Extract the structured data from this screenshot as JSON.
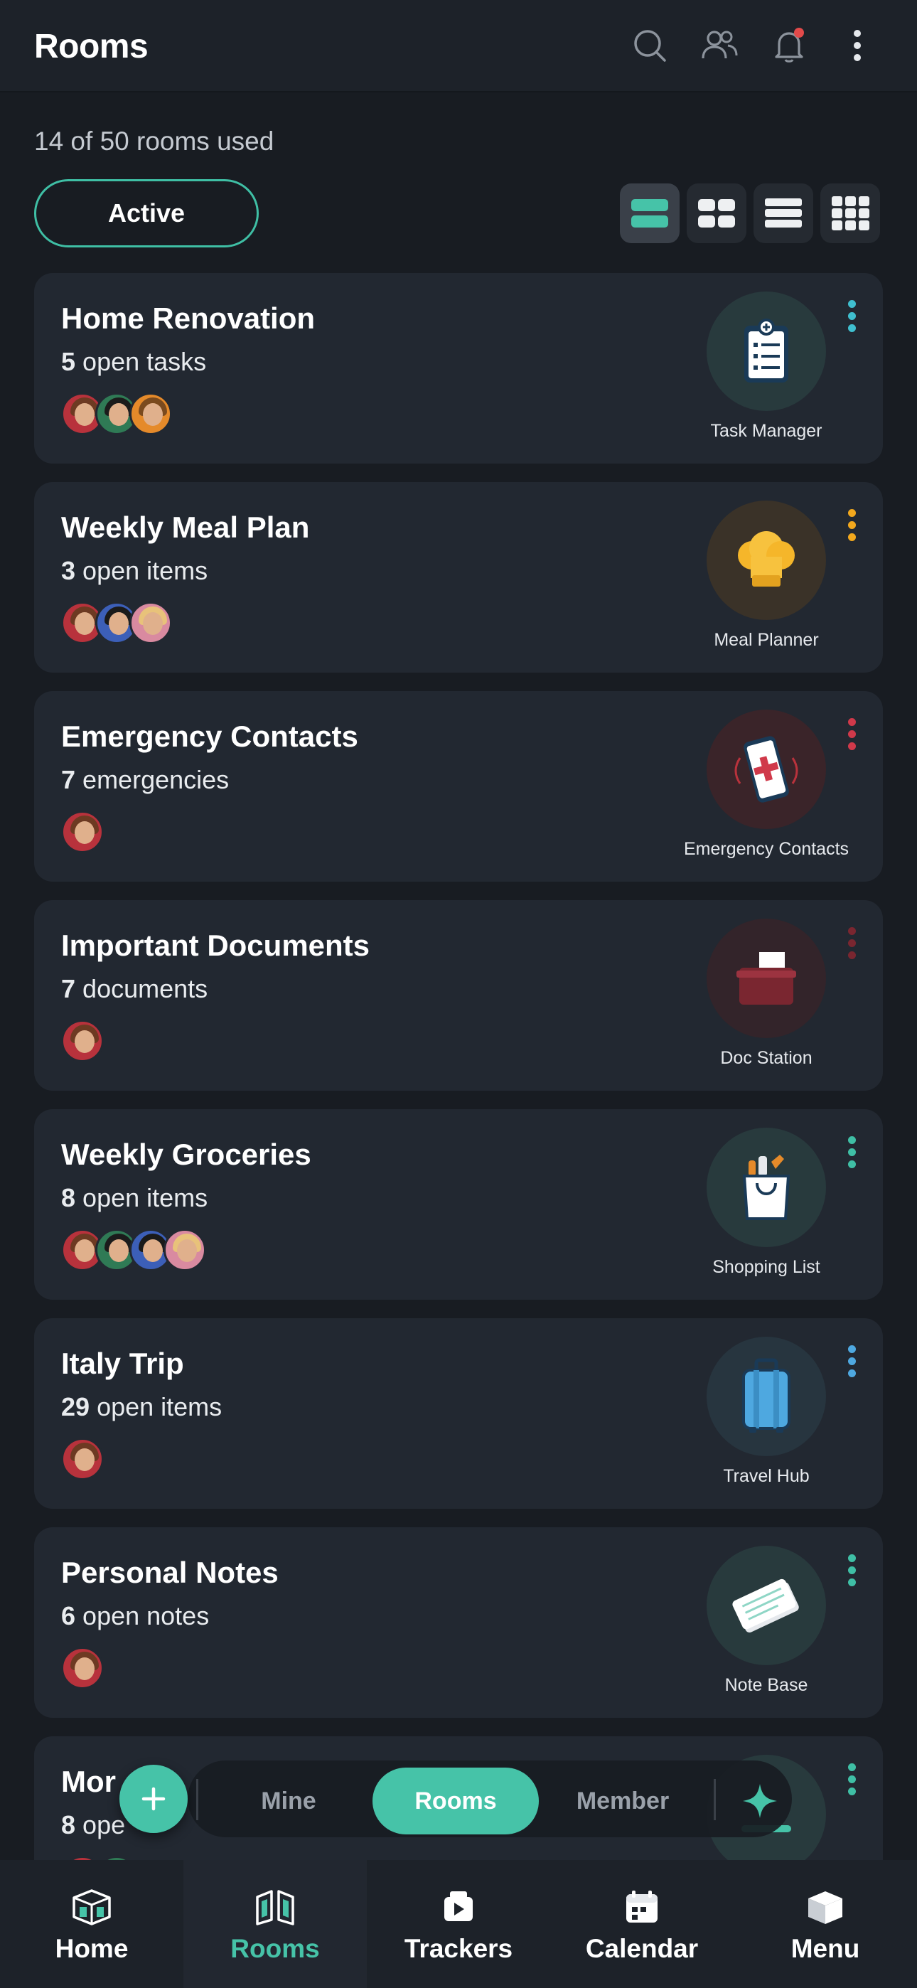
{
  "header": {
    "title": "Rooms",
    "icons": [
      "search-icon",
      "people-icon",
      "bell-icon",
      "more-vertical-icon"
    ],
    "notification_dot_color": "#e24a4a"
  },
  "usage_text": "14 of 50 rooms used",
  "filter": {
    "label": "Active"
  },
  "view_modes": {
    "options": [
      "list-large",
      "grid-2",
      "list-compact",
      "grid-3"
    ],
    "selected": "list-large"
  },
  "rooms": [
    {
      "name": "Home Renovation",
      "count": "5",
      "count_label": "open tasks",
      "app": "Task Manager",
      "icon": "clipboard-icon",
      "accent": "#3fbfcf",
      "members": 3
    },
    {
      "name": "Weekly Meal Plan",
      "count": "3",
      "count_label": "open items",
      "app": "Meal Planner",
      "icon": "chef-hat-icon",
      "accent": "#f2a81d",
      "members": 3
    },
    {
      "name": "Emergency Contacts",
      "count": "7",
      "count_label": "emergencies",
      "app": "Emergency Contacts",
      "icon": "phone-emergency-icon",
      "accent": "#d0394a",
      "members": 1
    },
    {
      "name": "Important Documents",
      "count": "7",
      "count_label": "documents",
      "app": "Doc Station",
      "icon": "folder-icon",
      "accent": "#7a2630",
      "members": 1
    },
    {
      "name": "Weekly Groceries",
      "count": "8",
      "count_label": "open items",
      "app": "Shopping List",
      "icon": "shopping-bag-icon",
      "accent": "#3fbfa5",
      "members": 4
    },
    {
      "name": "Italy Trip",
      "count": "29",
      "count_label": "open items",
      "app": "Travel Hub",
      "icon": "suitcase-icon",
      "accent": "#4ea8e0",
      "members": 1
    },
    {
      "name": "Personal Notes",
      "count": "6",
      "count_label": "open notes",
      "app": "Note Base",
      "icon": "notepad-icon",
      "accent": "#3fbfa5",
      "members": 1
    },
    {
      "name": "Mor",
      "count": "8",
      "count_label": "ope",
      "app": "",
      "icon": "app-icon",
      "accent": "#3fbfa5",
      "members": 2
    }
  ],
  "switcher": {
    "add_icon": "plus-icon",
    "tabs": [
      "Mine",
      "Rooms",
      "Member"
    ],
    "selected": "Rooms",
    "ai_icon": "sparkle-icon"
  },
  "bottom_nav": {
    "items": [
      {
        "label": "Home",
        "icon": "home-cube-icon"
      },
      {
        "label": "Rooms",
        "icon": "rooms-icon"
      },
      {
        "label": "Trackers",
        "icon": "tracker-icon"
      },
      {
        "label": "Calendar",
        "icon": "calendar-icon"
      },
      {
        "label": "Menu",
        "icon": "menu-cube-icon"
      }
    ],
    "selected": "Rooms"
  }
}
